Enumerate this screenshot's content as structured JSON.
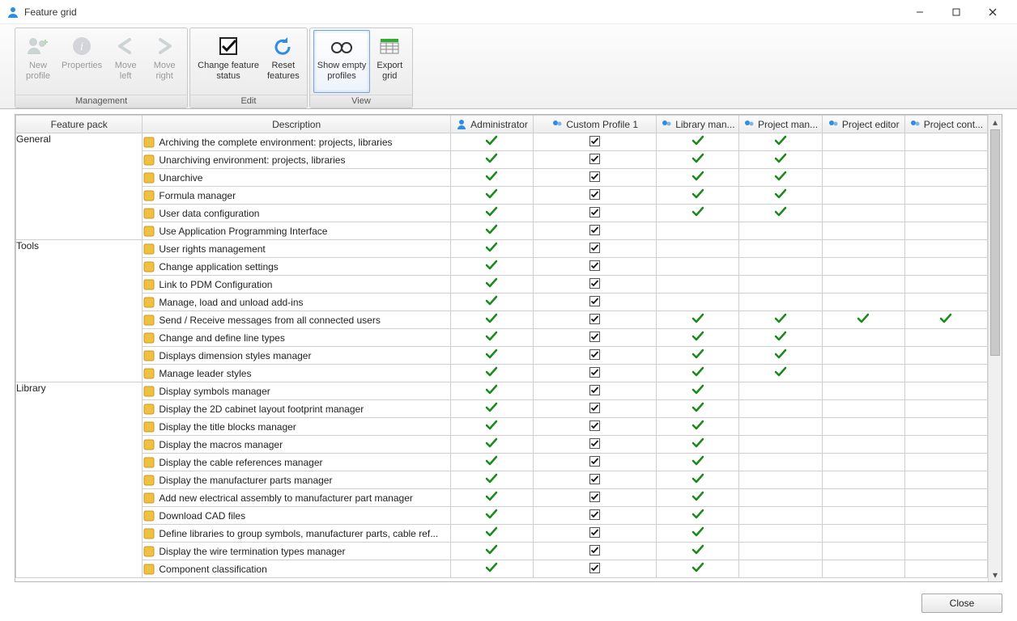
{
  "window": {
    "title": "Feature grid"
  },
  "ribbon": {
    "groups": {
      "management": {
        "label": "Management",
        "new_profile": "New\nprofile",
        "properties": "Properties",
        "move_left": "Move\nleft",
        "move_right": "Move\nright"
      },
      "edit": {
        "label": "Edit",
        "change_status": "Change feature\nstatus",
        "reset": "Reset\nfeatures"
      },
      "view": {
        "label": "View",
        "show_empty": "Show empty\nprofiles",
        "export": "Export\ngrid"
      }
    }
  },
  "headers": {
    "feature_pack": "Feature pack",
    "description": "Description",
    "profiles": [
      "Administrator",
      "Custom Profile 1",
      "Library man...",
      "Project man...",
      "Project editor",
      "Project cont..."
    ]
  },
  "packs": [
    {
      "name": "General",
      "rows": [
        {
          "label": "Archiving the complete environment: projects, libraries",
          "cells": [
            "g",
            "c",
            "g",
            "g",
            "w",
            "w"
          ]
        },
        {
          "label": "Unarchiving environment: projects, libraries",
          "cells": [
            "g",
            "c",
            "g",
            "g",
            "w",
            "w"
          ]
        },
        {
          "label": "Unarchive",
          "cells": [
            "g",
            "c",
            "g",
            "g",
            "w",
            "w"
          ]
        },
        {
          "label": "Formula manager",
          "cells": [
            "g",
            "c",
            "g",
            "g",
            "w",
            "w"
          ]
        },
        {
          "label": "User data configuration",
          "cells": [
            "g",
            "c",
            "g",
            "g",
            "w",
            "w"
          ]
        },
        {
          "label": "Use Application Programming Interface",
          "cells": [
            "g",
            "c",
            "w",
            "w",
            "w",
            "w"
          ]
        }
      ]
    },
    {
      "name": "Tools",
      "rows": [
        {
          "label": "User rights management",
          "cells": [
            "g",
            "c",
            "w",
            "w",
            "w",
            "w"
          ]
        },
        {
          "label": "Change application settings",
          "cells": [
            "g",
            "c",
            "w",
            "w",
            "w",
            "w"
          ]
        },
        {
          "label": "Link to PDM Configuration",
          "cells": [
            "g",
            "c",
            "w",
            "w",
            "w",
            "w"
          ]
        },
        {
          "label": "Manage, load and unload add-ins",
          "cells": [
            "g",
            "c",
            "w",
            "w",
            "w",
            "w"
          ]
        },
        {
          "label": "Send / Receive messages from all connected users",
          "cells": [
            "g",
            "c",
            "g",
            "g",
            "gw",
            "gw"
          ]
        },
        {
          "label": "Change and define line types",
          "cells": [
            "g",
            "c",
            "g",
            "g",
            "w",
            "w"
          ]
        },
        {
          "label": "Displays dimension styles manager",
          "cells": [
            "g",
            "c",
            "g",
            "g",
            "w",
            "w"
          ]
        },
        {
          "label": "Manage leader styles",
          "cells": [
            "g",
            "c",
            "g",
            "g",
            "w",
            "w"
          ]
        }
      ]
    },
    {
      "name": "Library",
      "rows": [
        {
          "label": "Display symbols manager",
          "cells": [
            "g",
            "c",
            "g",
            "w",
            "w",
            "w"
          ]
        },
        {
          "label": "Display the 2D cabinet layout footprint manager",
          "cells": [
            "g",
            "c",
            "g",
            "w",
            "w",
            "w"
          ]
        },
        {
          "label": "Display the title blocks manager",
          "cells": [
            "g",
            "c",
            "g",
            "w",
            "w",
            "w"
          ]
        },
        {
          "label": "Display the macros manager",
          "cells": [
            "g",
            "c",
            "g",
            "w",
            "w",
            "w"
          ]
        },
        {
          "label": "Display the cable references manager",
          "cells": [
            "g",
            "c",
            "g",
            "w",
            "w",
            "w"
          ]
        },
        {
          "label": "Display the manufacturer parts manager",
          "cells": [
            "g",
            "c",
            "g",
            "w",
            "w",
            "w"
          ]
        },
        {
          "label": "Add new electrical assembly to manufacturer part manager",
          "cells": [
            "g",
            "c",
            "g",
            "w",
            "w",
            "w"
          ]
        },
        {
          "label": "Download CAD files",
          "cells": [
            "g",
            "c",
            "g",
            "w",
            "w",
            "w"
          ]
        },
        {
          "label": "Define libraries to group symbols, manufacturer parts, cable ref...",
          "cells": [
            "g",
            "c",
            "g",
            "w",
            "w",
            "w"
          ]
        },
        {
          "label": "Display the wire termination types manager",
          "cells": [
            "g",
            "c",
            "g",
            "w",
            "w",
            "w"
          ]
        },
        {
          "label": "Component classification",
          "cells": [
            "g",
            "c",
            "g",
            "w",
            "w",
            "w"
          ]
        }
      ]
    }
  ],
  "footer": {
    "close": "Close"
  }
}
